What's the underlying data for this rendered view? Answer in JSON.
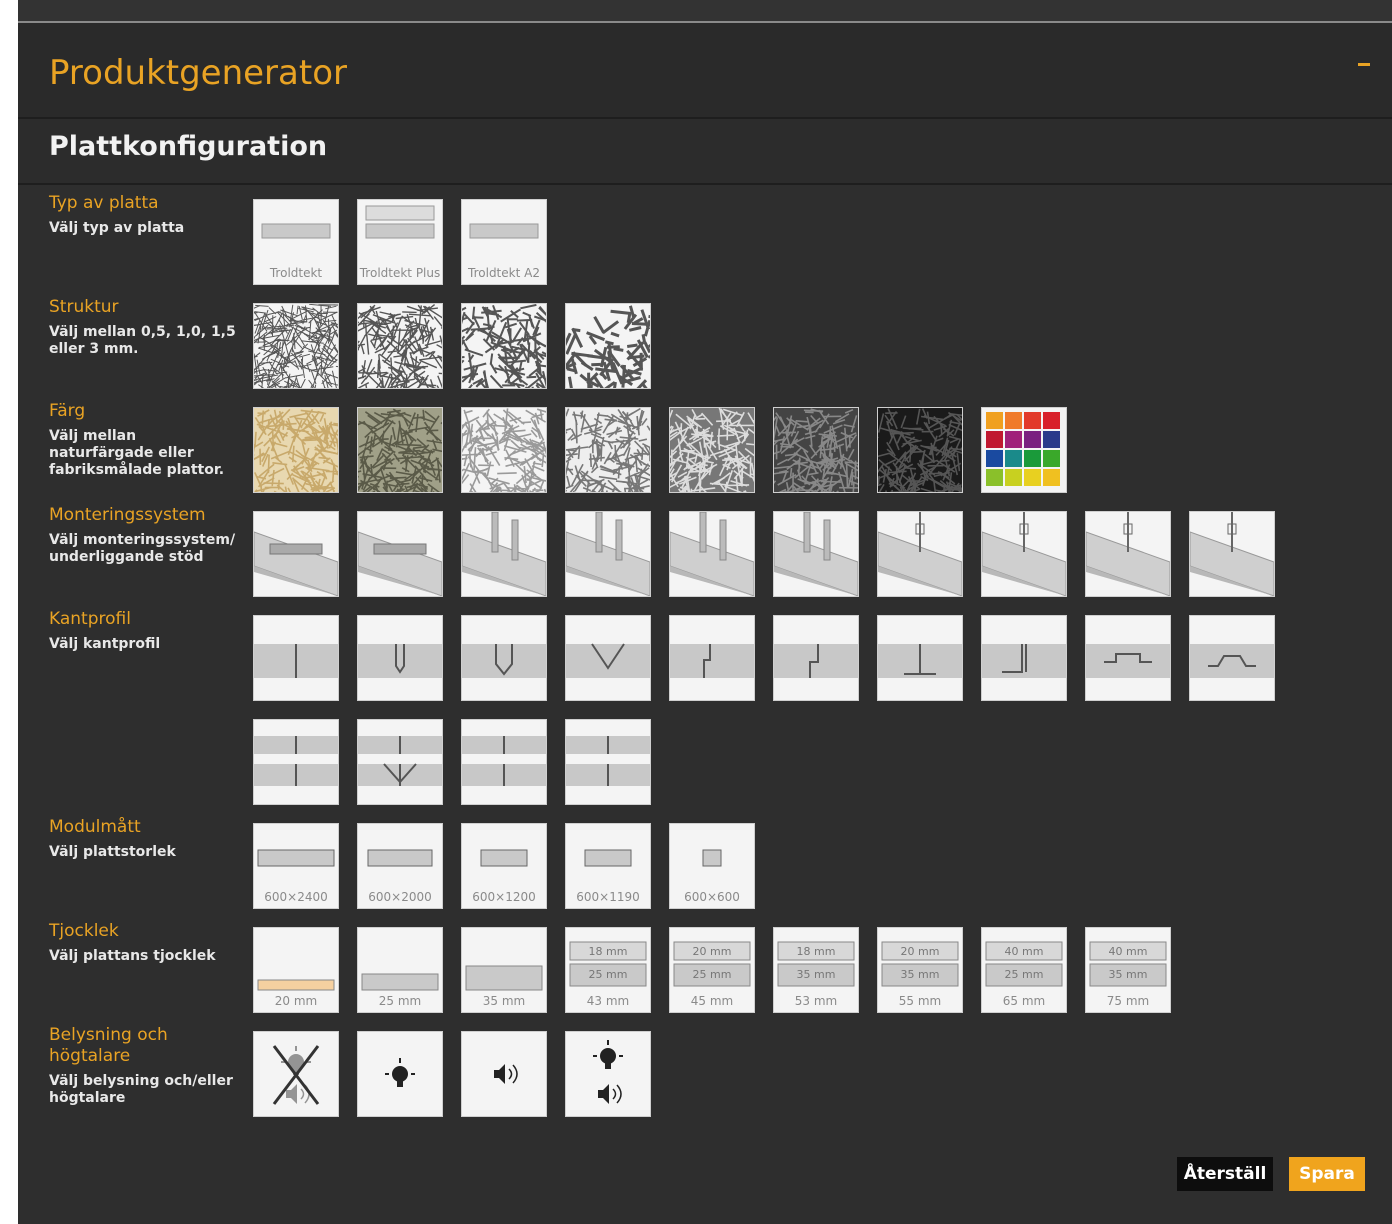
{
  "header": {
    "title": "Produktgenerator"
  },
  "section": {
    "title": "Plattkonfiguration"
  },
  "groups": {
    "typ": {
      "title": "Typ av platta",
      "subtitle": "Välj typ av platta"
    },
    "struktur": {
      "title": "Struktur",
      "subtitle": "Välj mellan 0,5, 1,0, 1,5 eller 3 mm."
    },
    "farg": {
      "title": "Färg",
      "subtitle": "Välj mellan naturfärgade eller fabriksmålade plattor."
    },
    "montering": {
      "title": "Monteringssystem",
      "subtitle": "Välj monteringssystem/ underliggande stöd"
    },
    "kantprofil": {
      "title": "Kantprofil",
      "subtitle": "Välj kantprofil"
    },
    "modulmatt": {
      "title": "Modulmått",
      "subtitle": "Välj plattstorlek"
    },
    "tjocklek": {
      "title": "Tjocklek",
      "subtitle": "Välj plattans tjocklek"
    },
    "belysning": {
      "title": "Belysning och högtalare",
      "subtitle": "Välj belysning och/eller högtalare"
    }
  },
  "typ_options": [
    "Troldtekt",
    "Troldtekt Plus",
    "Troldtekt A2"
  ],
  "modul_options": [
    "600×2400",
    "600×2000",
    "600×1200",
    "600×1190",
    "600×600"
  ],
  "tjocklek_options": [
    {
      "label": "20 mm",
      "layers": []
    },
    {
      "label": "25 mm",
      "layers": []
    },
    {
      "label": "35 mm",
      "layers": []
    },
    {
      "label": "43 mm",
      "layers": [
        "18 mm",
        "25 mm"
      ]
    },
    {
      "label": "45 mm",
      "layers": [
        "20 mm",
        "25 mm"
      ]
    },
    {
      "label": "53 mm",
      "layers": [
        "18 mm",
        "35 mm"
      ]
    },
    {
      "label": "55 mm",
      "layers": [
        "20 mm",
        "35 mm"
      ]
    },
    {
      "label": "65 mm",
      "layers": [
        "40 mm",
        "25 mm"
      ]
    },
    {
      "label": "75 mm",
      "layers": [
        "40 mm",
        "35 mm"
      ]
    }
  ],
  "colors": {
    "accent": "#e9a324",
    "panel": "#2e2e2e",
    "palette": [
      "#f0a020",
      "#f07a2a",
      "#e23a2a",
      "#d8202a",
      "#c01830",
      "#a0207a",
      "#7a2080",
      "#2a3a8a",
      "#1a4aa0",
      "#1a8a8a",
      "#1a9a3a",
      "#3aa82a",
      "#8ac02a",
      "#c8d020",
      "#e8d020",
      "#f0c020"
    ]
  },
  "actions": {
    "reset": "Återställ",
    "save": "Spara"
  }
}
